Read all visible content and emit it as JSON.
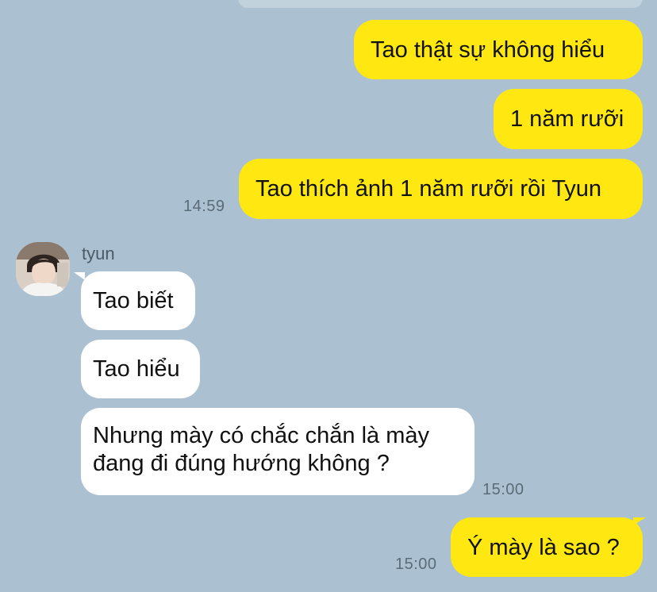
{
  "chat": {
    "contact_name": "tyun",
    "messages": [
      {
        "direction": "out",
        "text": "Tao thật sự không hiểu"
      },
      {
        "direction": "out",
        "text": "1 năm rưỡi"
      },
      {
        "direction": "out",
        "text": "Tao thích ảnh 1 năm rưỡi rồi Tyun",
        "time": "14:59"
      },
      {
        "direction": "in",
        "sender": "tyun",
        "text": "Tao biết"
      },
      {
        "direction": "in",
        "text": "Tao hiểu"
      },
      {
        "direction": "in",
        "text": "Nhưng mày có chắc chắn là mày đang đi đúng hướng không ?",
        "time": "15:00"
      },
      {
        "direction": "out",
        "text": "Ý mày là sao ?",
        "time": "15:00"
      }
    ]
  },
  "colors": {
    "background": "#abc1d1",
    "outgoing_bubble": "#ffe812",
    "incoming_bubble": "#ffffff",
    "timestamp_text": "#5b6b77"
  },
  "icons": {
    "avatar": "profile-photo"
  }
}
